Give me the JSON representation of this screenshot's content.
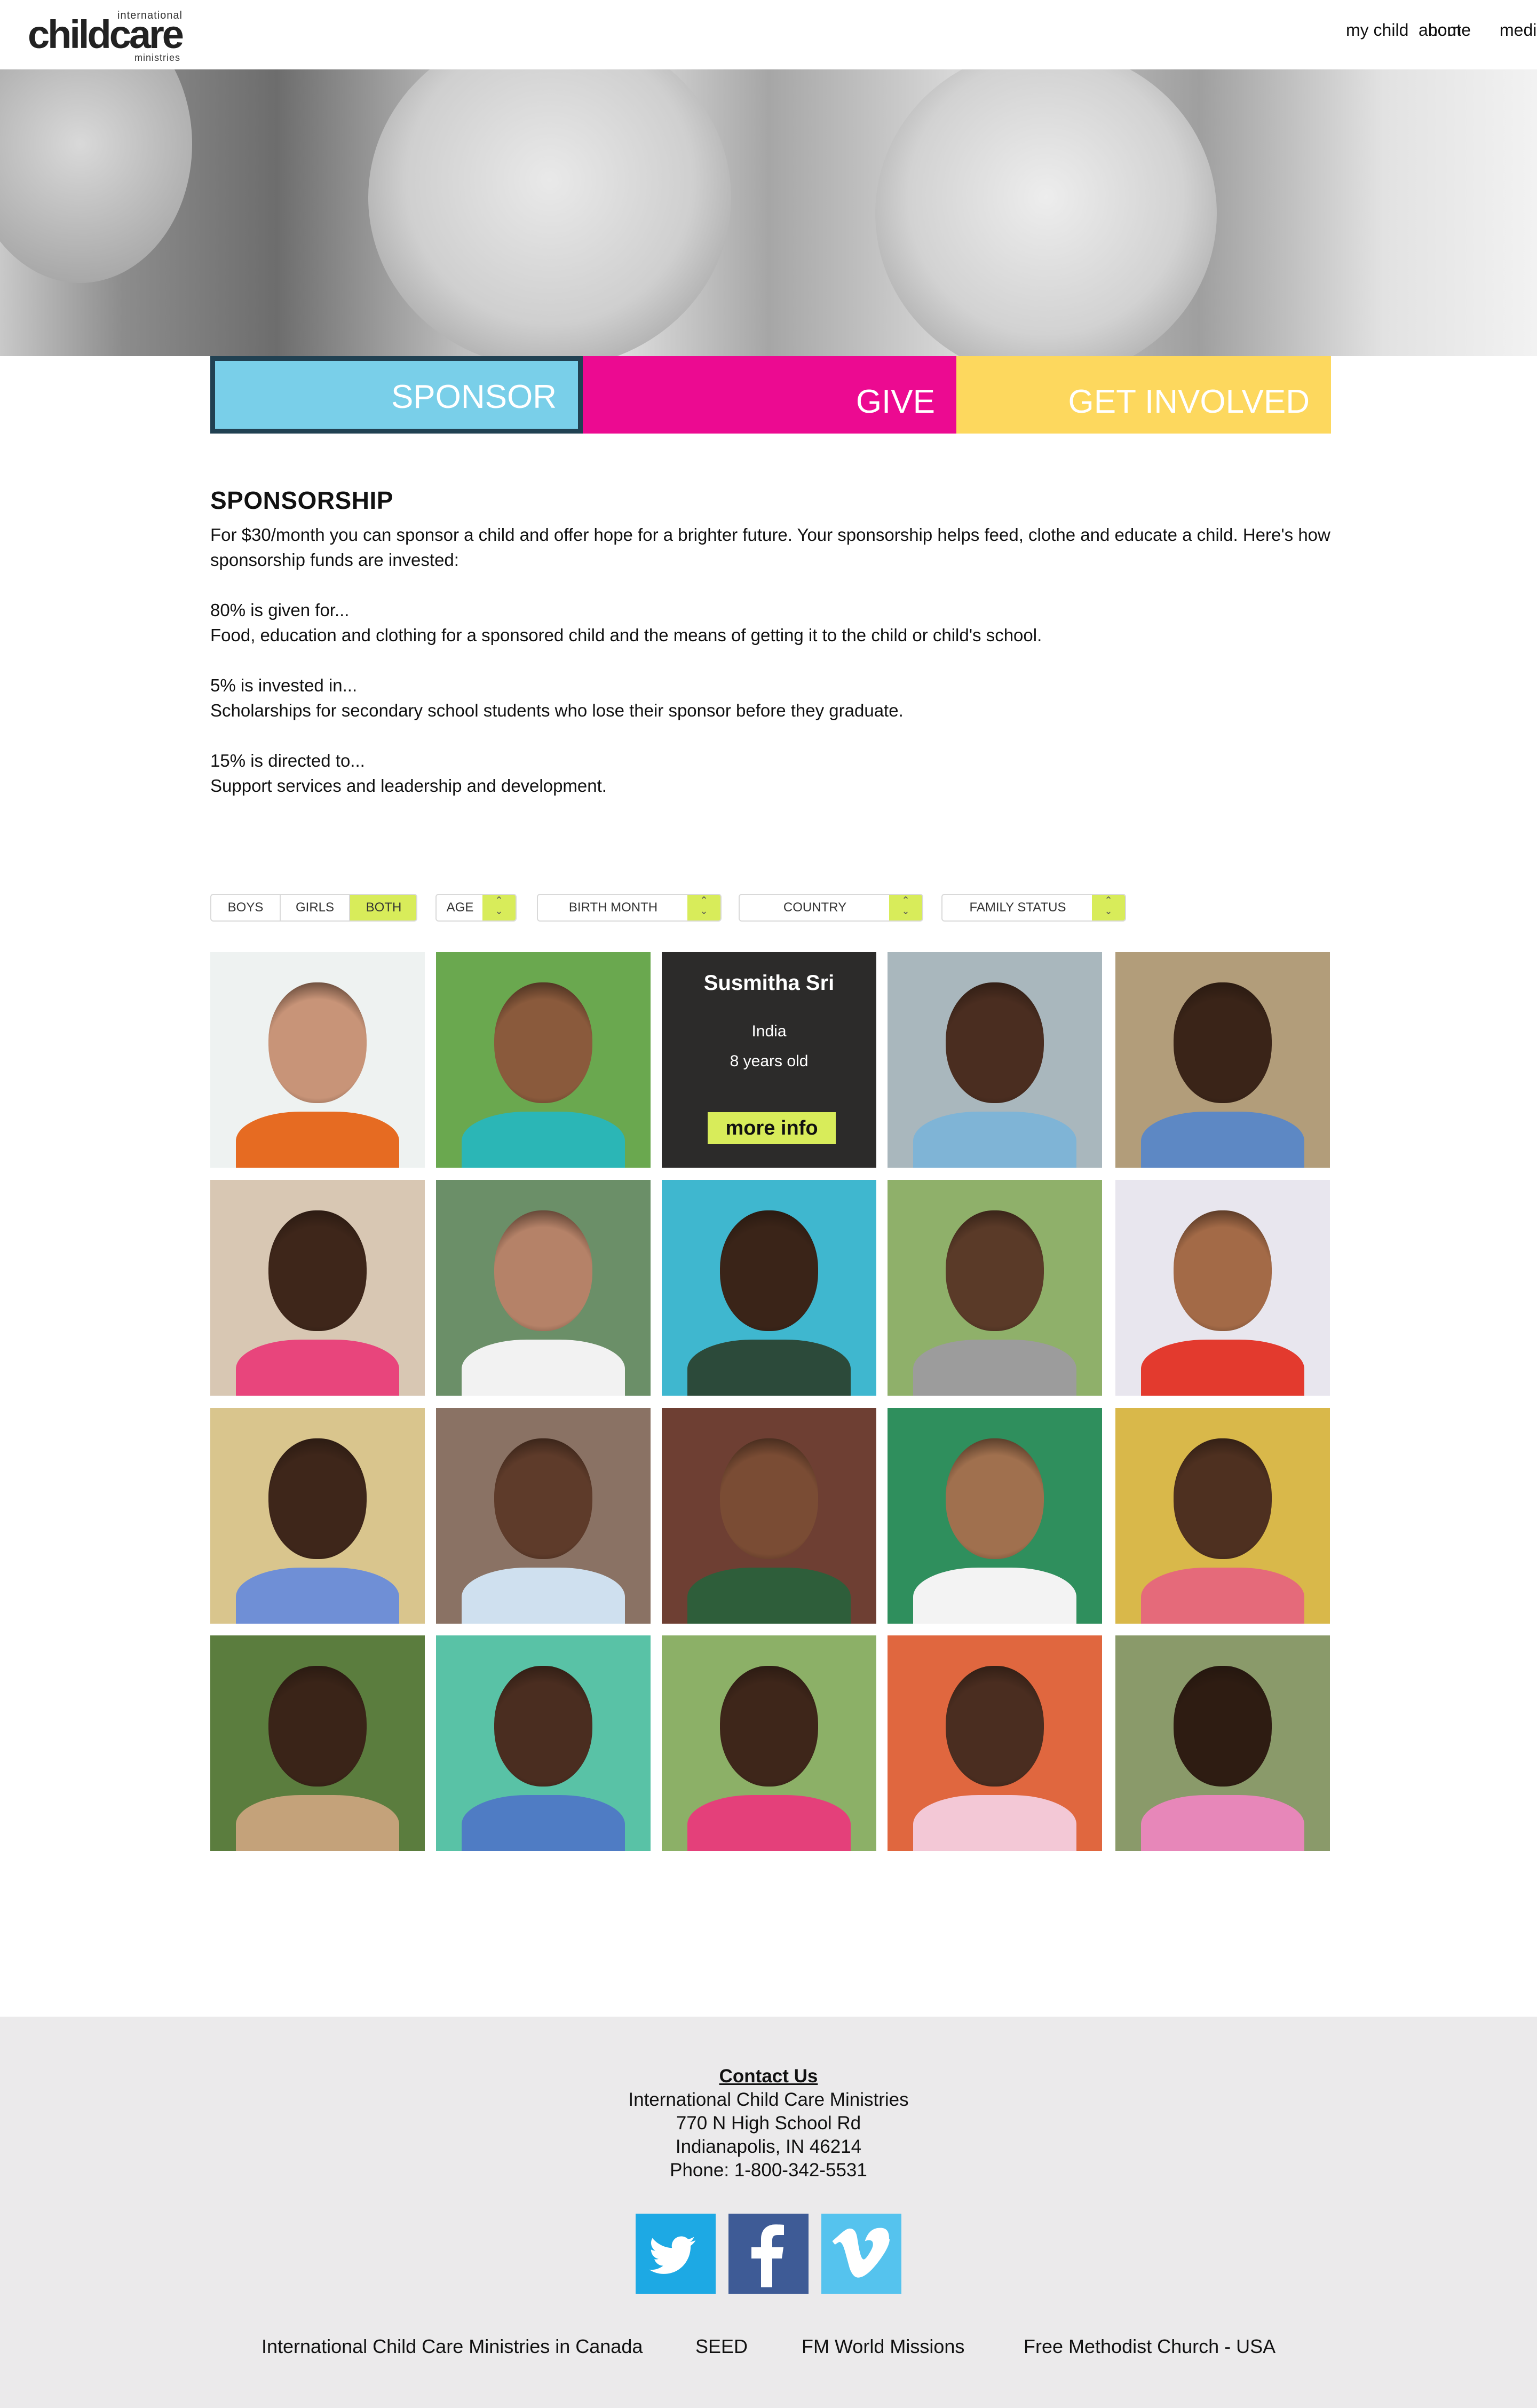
{
  "header": {
    "logo": {
      "word1": "child",
      "word2": "care",
      "top_text": "international",
      "bottom_text": "ministries"
    },
    "nav": [
      "my child",
      "about",
      "media",
      "home"
    ]
  },
  "tabs": [
    {
      "label": "SPONSOR",
      "color": "#79cfe9",
      "active": true
    },
    {
      "label": "GIVE",
      "color": "#ec0a91",
      "active": false
    },
    {
      "label": "GET INVOLVED",
      "color": "#fdd85e",
      "active": false
    }
  ],
  "sponsorship": {
    "title": "SPONSORSHIP",
    "intro": "For $30/month you can sponsor a child and offer hope for a brighter future. Your  sponsorship helps feed, clothe and educate a child. Here's how sponsorship funds are invested:",
    "items": [
      {
        "heading": "80% is given for...",
        "text": "Food, education and clothing for a sponsored child and the means of getting it to the child or child's school."
      },
      {
        "heading": "5% is invested in...",
        "text": "Scholarships for secondary school students who lose their sponsor before they graduate."
      },
      {
        "heading": "15% is directed to...",
        "text": "Support services and leadership and development."
      }
    ]
  },
  "filters": {
    "gender": {
      "options": [
        "BOYS",
        "GIRLS",
        "BOTH"
      ],
      "selected": "BOTH"
    },
    "selects": [
      "AGE",
      "BIRTH MONTH",
      "COUNTRY",
      "FAMILY STATUS"
    ]
  },
  "children_grid": {
    "hover_card": {
      "name": "Susmitha Sri",
      "country": "India",
      "age": "8 years old",
      "button": "more info"
    },
    "photos": [
      {
        "bg": "#eef2f1",
        "skin": "#c89478",
        "shirt": "#e66b22"
      },
      {
        "bg": "#6aa84f",
        "skin": "#8a5a3c",
        "shirt": "#2bb6b6"
      },
      {
        "overlay": true
      },
      {
        "bg": "#a9b7bd",
        "skin": "#4a2d20",
        "shirt": "#7fb4d6"
      },
      {
        "bg": "#b29d7a",
        "skin": "#3a2418",
        "shirt": "#5d88c4"
      },
      {
        "bg": "#d8c7b3",
        "skin": "#3e261a",
        "shirt": "#e8457c"
      },
      {
        "bg": "#6b8f68",
        "skin": "#b58268",
        "shirt": "#f2f2f2"
      },
      {
        "bg": "#3fb7cf",
        "skin": "#3a2418",
        "shirt": "#2c4a3a"
      },
      {
        "bg": "#8fb06a",
        "skin": "#5a3a28",
        "shirt": "#9c9c9c"
      },
      {
        "bg": "#e8e6ee",
        "skin": "#a36a47",
        "shirt": "#e33a2e"
      },
      {
        "bg": "#d9c58d",
        "skin": "#3e261a",
        "shirt": "#6f8fd6"
      },
      {
        "bg": "#8a7264",
        "skin": "#5e3b2a",
        "shirt": "#cfe0ef"
      },
      {
        "bg": "#6e3f33",
        "skin": "#7a4c34",
        "shirt": "#2e5e3a"
      },
      {
        "bg": "#2f8f5d",
        "skin": "#a0704e",
        "shirt": "#f3f3f3"
      },
      {
        "bg": "#d9b84a",
        "skin": "#4e3020",
        "shirt": "#e56a7a"
      },
      {
        "bg": "#5b7d3e",
        "skin": "#3a2418",
        "shirt": "#c4a27a"
      },
      {
        "bg": "#59c2a6",
        "skin": "#4a2d20",
        "shirt": "#4f7cc4"
      },
      {
        "bg": "#8cb067",
        "skin": "#3e261a",
        "shirt": "#e4407a"
      },
      {
        "bg": "#e0673f",
        "skin": "#4a2d20",
        "shirt": "#f3c8d6"
      },
      {
        "bg": "#8a9a6a",
        "skin": "#2e1c12",
        "shirt": "#e787b9"
      }
    ]
  },
  "footer": {
    "contact_title": "Contact Us",
    "address": [
      "International Child Care Ministries",
      "770 N High School Rd",
      "Indianapolis, IN 46214",
      "Phone: 1-800-342-5531"
    ],
    "social": [
      {
        "name": "twitter",
        "color": "#1da9e4"
      },
      {
        "name": "facebook",
        "color": "#3e5b96"
      },
      {
        "name": "vimeo",
        "color": "#55c3ee"
      }
    ],
    "links": [
      "International Child Care Ministries in Canada",
      "SEED",
      "FM World Missions",
      "Free Methodist Church - USA"
    ]
  }
}
